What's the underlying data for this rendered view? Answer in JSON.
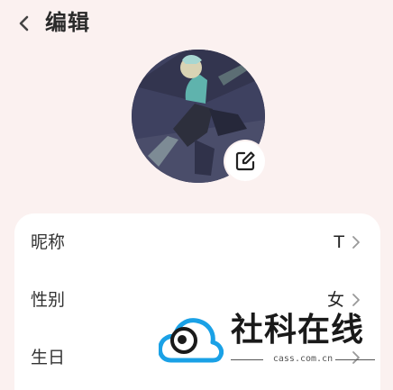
{
  "header": {
    "title": "编辑"
  },
  "profile": {
    "edit_icon": "edit-square-icon"
  },
  "fields": [
    {
      "label": "昵称",
      "value": "T"
    },
    {
      "label": "性别",
      "value": "女"
    },
    {
      "label": "生日",
      "value": ""
    }
  ],
  "watermark": {
    "name": "社科在线",
    "url": "cass.com.cn"
  },
  "colors": {
    "background": "#fbf1f0",
    "card": "#ffffff",
    "watermark_blue": "#1aa1e6"
  }
}
